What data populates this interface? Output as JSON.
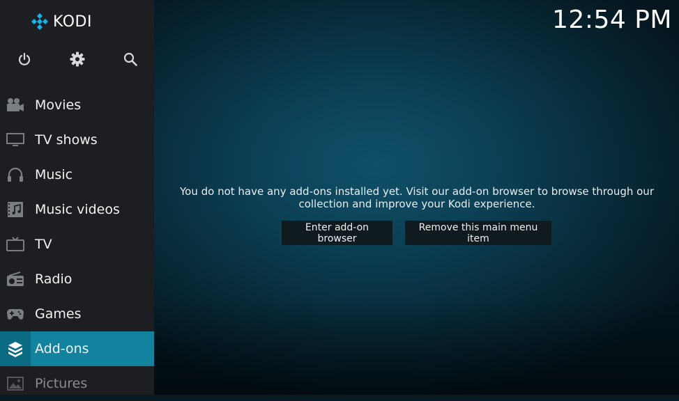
{
  "app": {
    "name": "KODI"
  },
  "clock": "12:54 PM",
  "top_controls": [
    {
      "name": "power",
      "icon": "power-icon"
    },
    {
      "name": "settings",
      "icon": "gear-icon"
    },
    {
      "name": "search",
      "icon": "search-icon"
    }
  ],
  "menu": {
    "items": [
      {
        "label": "Movies",
        "icon": "movie-camera-icon"
      },
      {
        "label": "TV shows",
        "icon": "monitor-icon"
      },
      {
        "label": "Music",
        "icon": "headphones-icon"
      },
      {
        "label": "Music videos",
        "icon": "music-video-icon"
      },
      {
        "label": "TV",
        "icon": "tv-icon"
      },
      {
        "label": "Radio",
        "icon": "radio-icon"
      },
      {
        "label": "Games",
        "icon": "gamepad-icon"
      },
      {
        "label": "Add-ons",
        "icon": "addons-box-icon",
        "active": true
      },
      {
        "label": "Pictures",
        "icon": "picture-icon"
      }
    ]
  },
  "main": {
    "message": "You do not have any add-ons installed yet. Visit our add-on browser to browse through our collection and improve your Kodi experience.",
    "buttons": {
      "enter_browser": "Enter add-on browser",
      "remove_item": "Remove this main menu item"
    }
  },
  "colors": {
    "accent": "#12839f",
    "sidebar_bg": "#1c1e21",
    "main_bg": "#0c3f54",
    "logo_blue": "#17b2e7"
  }
}
